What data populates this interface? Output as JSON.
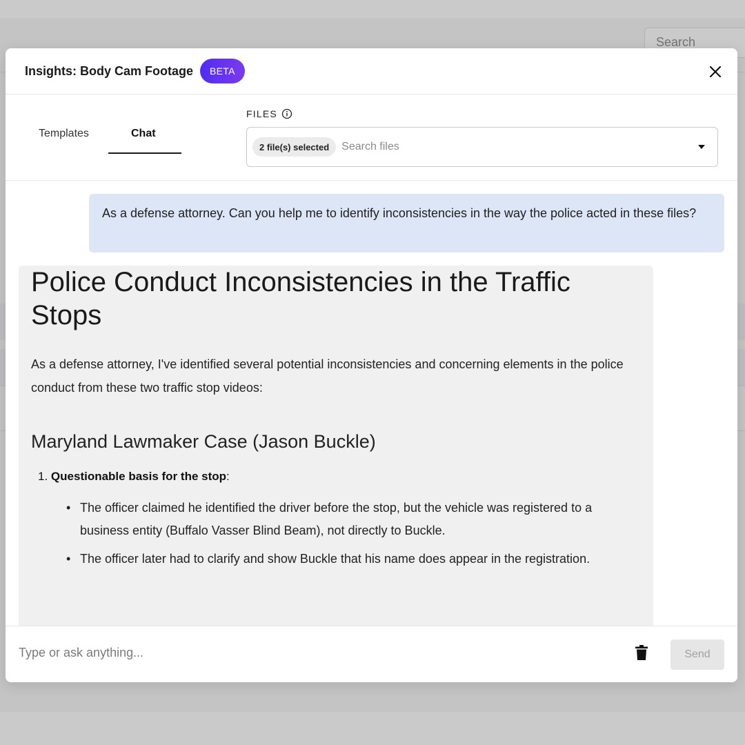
{
  "background": {
    "search_placeholder": "Search"
  },
  "modal": {
    "title": "Insights: Body Cam Footage",
    "badge": "BETA",
    "tabs": [
      {
        "label": "Templates",
        "active": false
      },
      {
        "label": "Chat",
        "active": true
      }
    ],
    "files": {
      "label": "FILES",
      "selected_chip": "2 file(s) selected",
      "search_placeholder": "Search files"
    }
  },
  "chat": {
    "user_message": "As a defense attorney. Can you help me to identify inconsistencies in the way the police acted in these files?",
    "assistant": {
      "heading": "Police Conduct Inconsistencies in the Traffic Stops",
      "intro": "As a defense attorney, I've identified several potential inconsistencies and concerning elements in the police conduct from these two traffic stop videos:",
      "section_title": "Maryland Lawmaker Case (Jason Buckle)",
      "points": [
        {
          "number": "1.",
          "title": "Questionable basis for the stop",
          "bullets": [
            "The officer claimed he identified the driver before the stop, but the vehicle was registered to a business entity (Buffalo Vasser Blind Beam), not directly to Buckle.",
            "The officer later had to clarify and show Buckle that his name does appear in the registration."
          ]
        }
      ]
    }
  },
  "input": {
    "placeholder": "Type or ask anything...",
    "send_label": "Send"
  },
  "icons": {
    "close": "close-icon",
    "info": "info-icon",
    "dropdown": "chevron-down-icon",
    "trash": "trash-icon"
  },
  "colors": {
    "badge_gradient_start": "#4f2df0",
    "badge_gradient_end": "#7c3aed",
    "user_bubble": "#dde6f7",
    "assistant_bubble": "#f0f0f0"
  }
}
